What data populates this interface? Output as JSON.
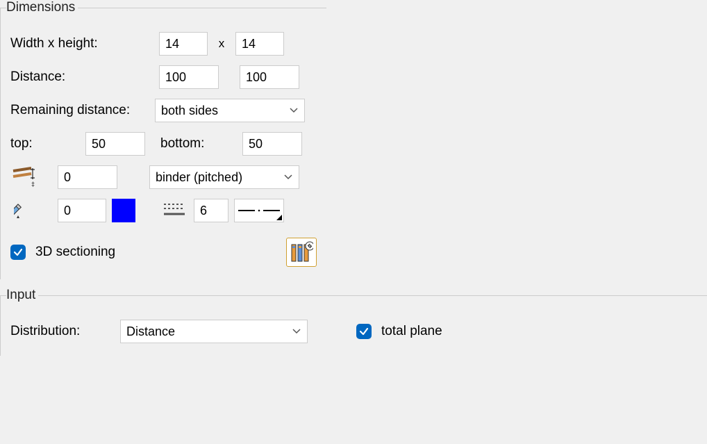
{
  "dimensions": {
    "legend": "Dimensions",
    "width_height_label": "Width x height:",
    "width_value": "14",
    "x_separator": "x",
    "height_value": "14",
    "distance_label": "Distance:",
    "distance_value_1": "100",
    "distance_value_2": "100",
    "remaining_label": "Remaining distance:",
    "remaining_selected": "both sides",
    "top_label": "top:",
    "top_value": "50",
    "bottom_label": "bottom:",
    "bottom_value": "50",
    "binder_offset_value": "0",
    "binder_type_selected": "binder (pitched)",
    "pen_value": "0",
    "pen_color": "#0000ff",
    "linetype_value": "6",
    "sectioning_checkbox_label": "3D sectioning"
  },
  "input": {
    "legend": "Input",
    "distribution_label": "Distribution:",
    "distribution_selected": "Distance",
    "total_plane_label": "total plane"
  }
}
